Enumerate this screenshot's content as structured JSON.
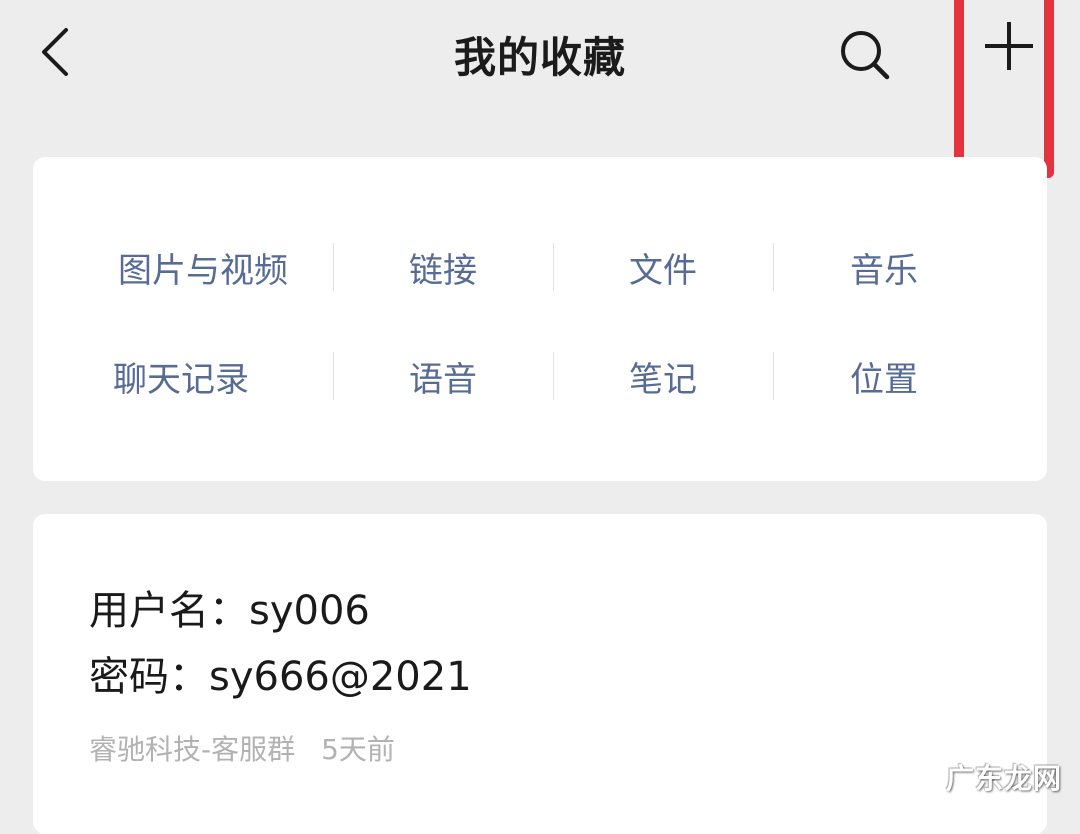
{
  "header": {
    "title": "我的收藏",
    "back_icon": "chevron-left-icon",
    "search_icon": "search-icon",
    "add_icon": "plus-icon",
    "highlight_color": "#e5333e"
  },
  "categories": {
    "row1": [
      "图片与视频",
      "链接",
      "文件",
      "音乐"
    ],
    "row2": [
      "聊天记录",
      "语音",
      "笔记",
      "位置"
    ],
    "link_color": "#576b95"
  },
  "favorite_item": {
    "line1": "用户名：sy006",
    "line2": "密码：sy666@2021",
    "source": "睿驰科技-客服群",
    "time": "5天前"
  },
  "watermark": "广东龙网"
}
